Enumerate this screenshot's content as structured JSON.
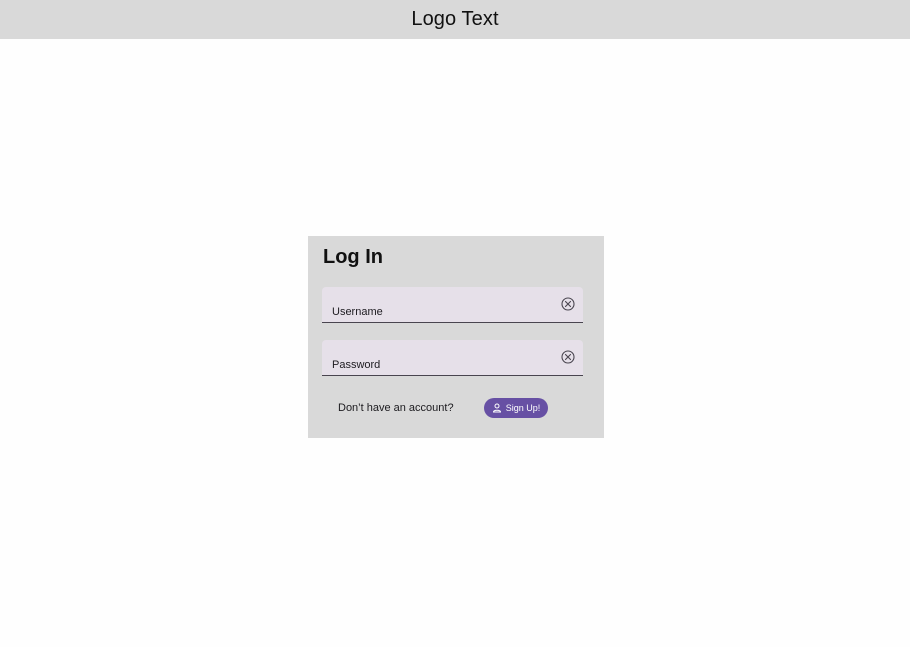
{
  "header": {
    "logo_text": "Logo Text"
  },
  "login": {
    "title": "Log In",
    "username": {
      "placeholder": "Username",
      "value": "",
      "clear_icon": "clear-circle-icon"
    },
    "password": {
      "placeholder": "Password",
      "value": "",
      "clear_icon": "clear-circle-icon"
    },
    "signup_prompt": "Don’t have an account?",
    "signup_button": {
      "label": "Sign Up!",
      "icon": "person-icon"
    }
  },
  "colors": {
    "header_bg": "#d9d9d9",
    "card_bg": "#d9d9d9",
    "field_bg": "#e6e0e9",
    "accent": "#6750a4",
    "page_bg": "#fefefe"
  }
}
